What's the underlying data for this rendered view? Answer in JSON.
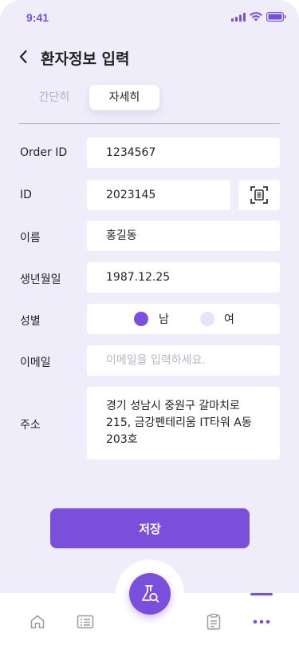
{
  "status_bar": {
    "time": "9:41"
  },
  "header": {
    "title": "환자정보 입력"
  },
  "tabs": [
    {
      "label": "간단히",
      "active": false
    },
    {
      "label": "자세히",
      "active": true
    }
  ],
  "form": {
    "order_id": {
      "label": "Order ID",
      "value": "1234567"
    },
    "id": {
      "label": "ID",
      "value": "2023145"
    },
    "name": {
      "label": "이름",
      "value": "홍길동"
    },
    "birth": {
      "label": "생년월일",
      "value": "1987.12.25"
    },
    "gender": {
      "label": "성별",
      "options": [
        {
          "label": "남",
          "selected": true
        },
        {
          "label": "여",
          "selected": false
        }
      ]
    },
    "email": {
      "label": "이메일",
      "value": "",
      "placeholder": "이메일을 입력하세요."
    },
    "address": {
      "label": "주소",
      "lines": [
        "경기 성남시 중원구 갈마치로",
        "215, 금강펜테리움 IT타워 A동",
        "203호"
      ]
    }
  },
  "save_label": "저장",
  "colors": {
    "accent": "#7a4fdb",
    "background": "#efedf9"
  },
  "bottom_nav": {
    "items": [
      {
        "icon": "home-icon"
      },
      {
        "icon": "list-icon"
      },
      {
        "icon": "flask-search-icon"
      },
      {
        "icon": "clipboard-icon"
      },
      {
        "icon": "more-icon",
        "active": true
      }
    ]
  }
}
